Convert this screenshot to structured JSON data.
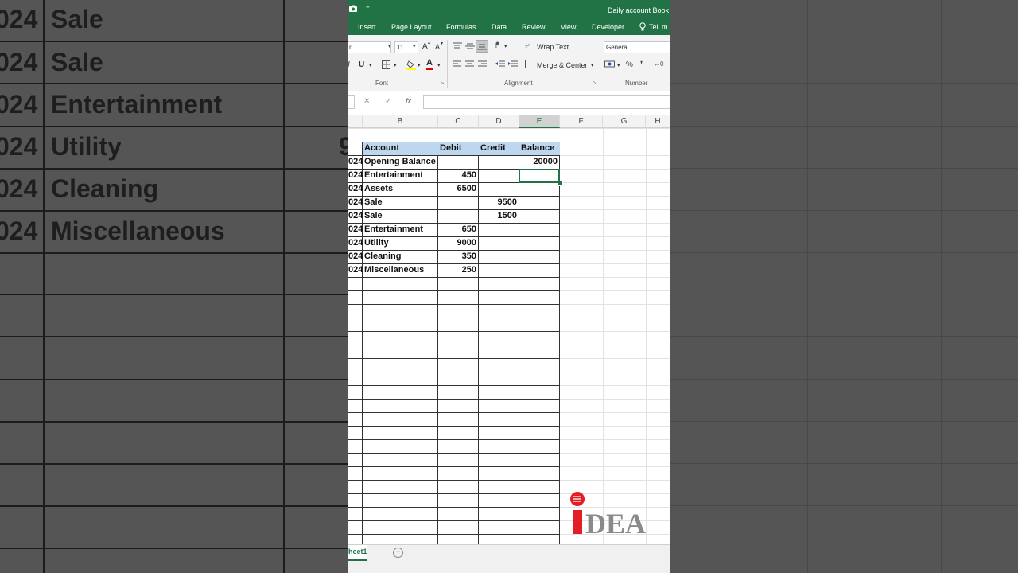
{
  "background": {
    "left_rows": [
      {
        "year": "024",
        "account": "Sale"
      },
      {
        "year": "024",
        "account": "Sale"
      },
      {
        "year": "024",
        "account": "Entertainment"
      },
      {
        "year": "024",
        "account": "Utility"
      },
      {
        "year": "024",
        "account": "Cleaning"
      },
      {
        "year": "024",
        "account": "Miscellaneous"
      }
    ],
    "stray_char": "9"
  },
  "window": {
    "title": "Daily account Book",
    "qat_more": "⁼"
  },
  "ribbon_tabs": [
    "Insert",
    "Page Layout",
    "Formulas",
    "Data",
    "Review",
    "View",
    "Developer"
  ],
  "tell_me": "Tell m",
  "ribbon": {
    "font_name": "ri",
    "font_size": "11",
    "grow_font": "A",
    "shrink_font": "A",
    "italic": "I",
    "underline": "U",
    "font_color": "A",
    "wrap_text": "Wrap Text",
    "merge_center": "Merge & Center",
    "number_format": "General",
    "percent": "%",
    "comma": "❜",
    "font_group": "Font",
    "alignment_group": "Alignment",
    "number_group": "Number"
  },
  "formula_bar": {
    "cancel": "✕",
    "enter": "✓",
    "fx": "fx",
    "value": ""
  },
  "columns": [
    "B",
    "C",
    "D",
    "E",
    "F",
    "G",
    "H"
  ],
  "table": {
    "headers": {
      "account": "Account",
      "debit": "Debit",
      "credit": "Credit",
      "balance": "Balance"
    },
    "rows": [
      {
        "date": "024",
        "account": "Opening Balance",
        "debit": "",
        "credit": "",
        "balance": "20000"
      },
      {
        "date": "024",
        "account": "Entertainment",
        "debit": "450",
        "credit": "",
        "balance": ""
      },
      {
        "date": "024",
        "account": "Assets",
        "debit": "6500",
        "credit": "",
        "balance": ""
      },
      {
        "date": "024",
        "account": "Sale",
        "debit": "",
        "credit": "9500",
        "balance": ""
      },
      {
        "date": "024",
        "account": "Sale",
        "debit": "",
        "credit": "1500",
        "balance": ""
      },
      {
        "date": "024",
        "account": "Entertainment",
        "debit": "650",
        "credit": "",
        "balance": ""
      },
      {
        "date": "024",
        "account": "Utility",
        "debit": "9000",
        "credit": "",
        "balance": ""
      },
      {
        "date": "024",
        "account": "Cleaning",
        "debit": "350",
        "credit": "",
        "balance": ""
      },
      {
        "date": "024",
        "account": "Miscellaneous",
        "debit": "250",
        "credit": "",
        "balance": ""
      }
    ]
  },
  "sheet_tab": "heet1",
  "add_sheet": "+",
  "watermark": {
    "text": "IDEA",
    "colors": {
      "i": "#e41e26",
      "dea": "#8a8a8a"
    }
  },
  "colors": {
    "excel_green": "#217346",
    "header_fill": "#bdd7ee",
    "selection": "#217346"
  }
}
